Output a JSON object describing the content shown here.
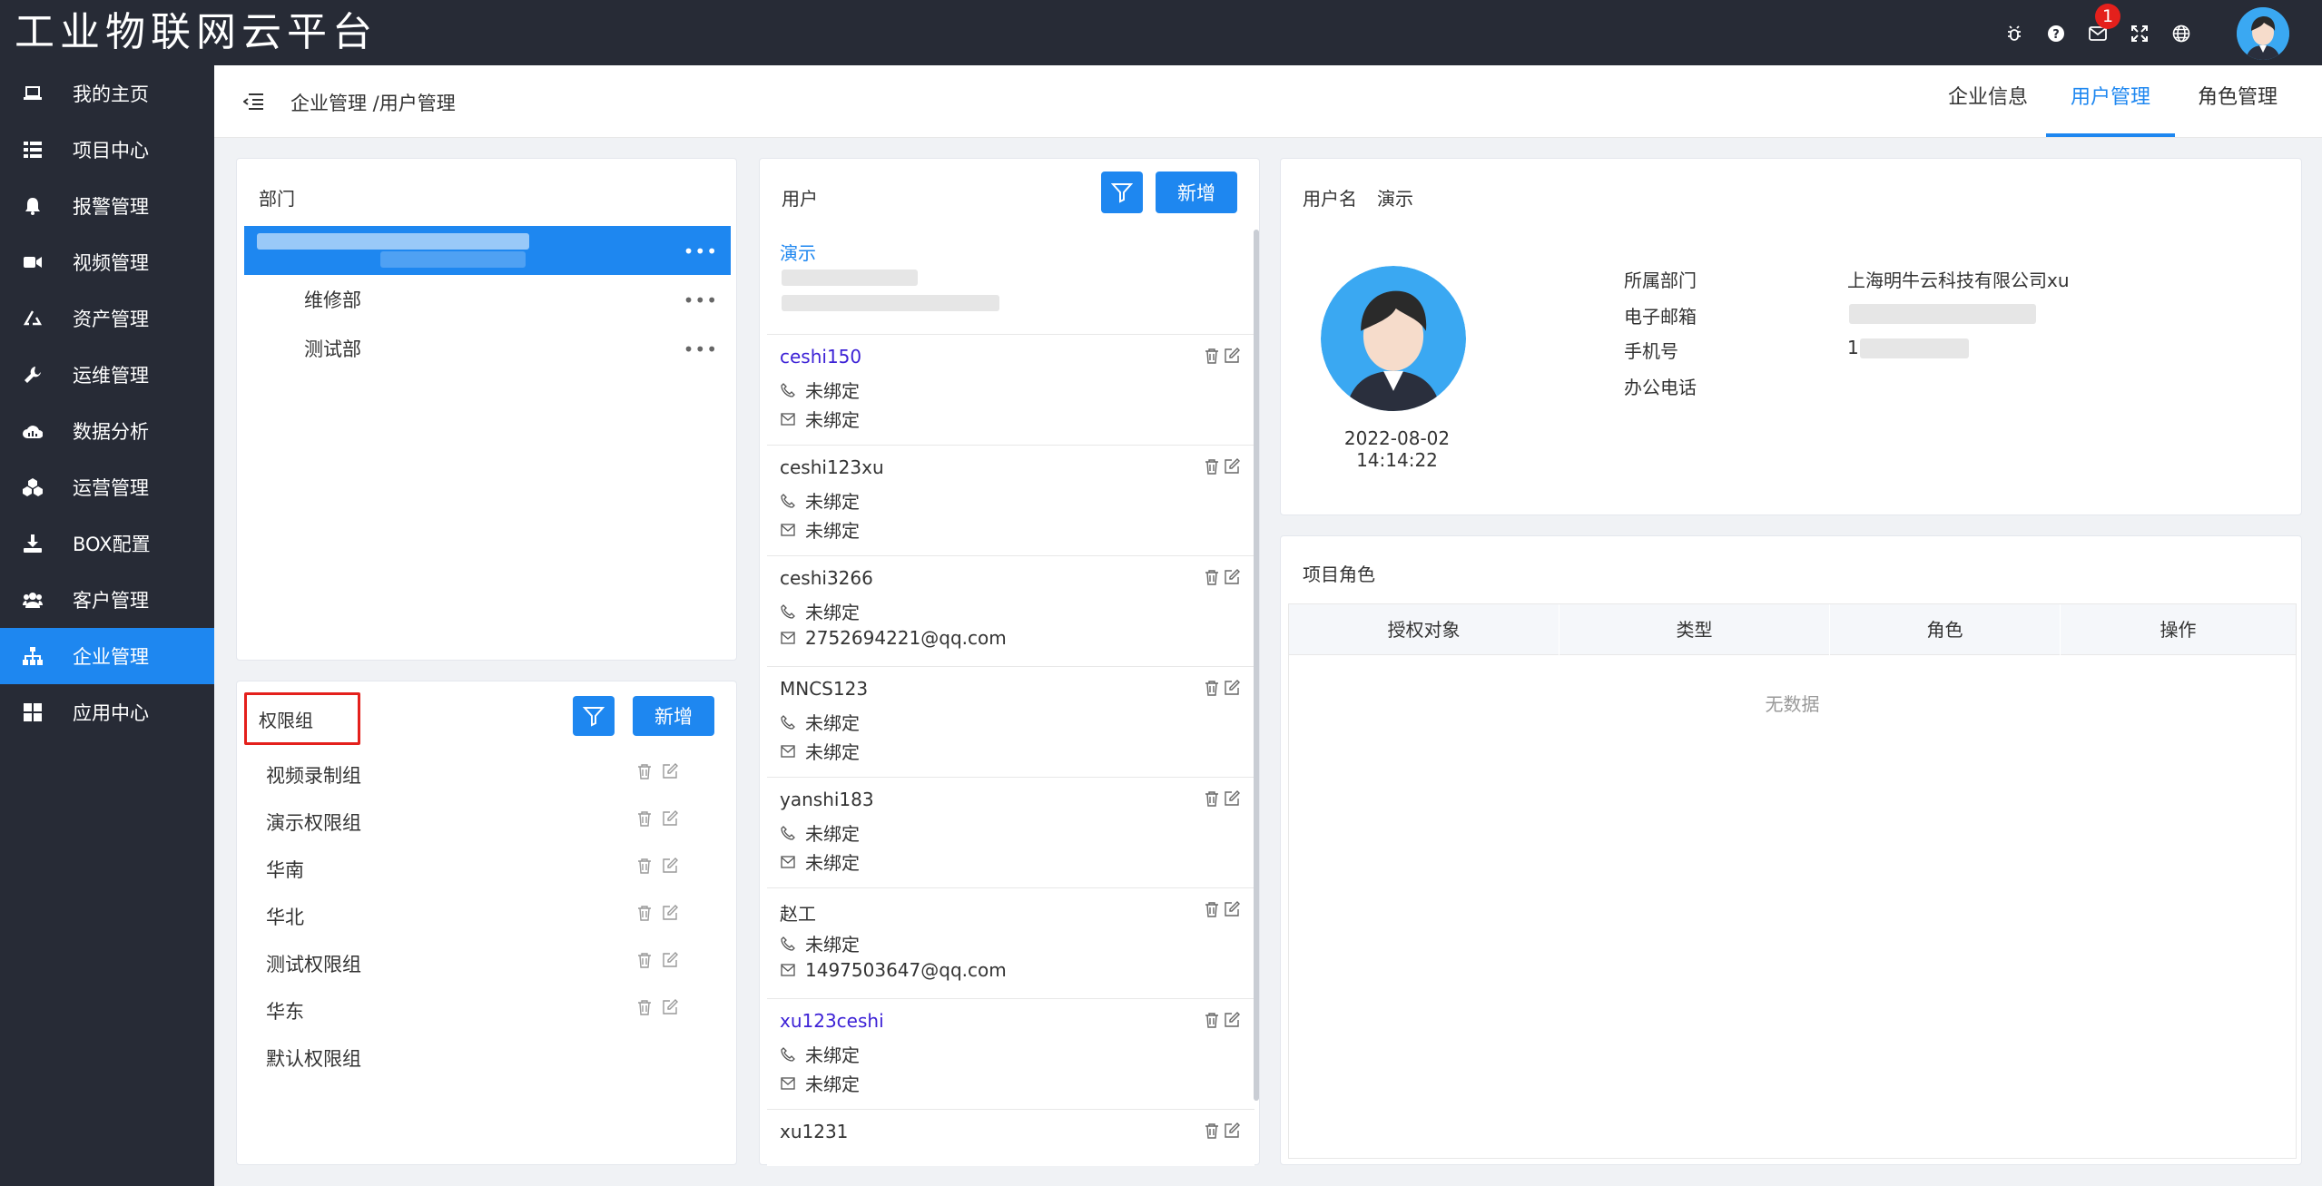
{
  "app": {
    "title": "工业物联网云平台"
  },
  "topbar": {
    "message_count": "1"
  },
  "sidebar": {
    "items": [
      {
        "label": "我的主页",
        "icon": "laptop-icon"
      },
      {
        "label": "项目中心",
        "icon": "list-icon"
      },
      {
        "label": "报警管理",
        "icon": "bell-icon"
      },
      {
        "label": "视频管理",
        "icon": "video-icon"
      },
      {
        "label": "资产管理",
        "icon": "recycle-icon"
      },
      {
        "label": "运维管理",
        "icon": "wrench-icon"
      },
      {
        "label": "数据分析",
        "icon": "cloud-chart-icon"
      },
      {
        "label": "运营管理",
        "icon": "cubes-icon"
      },
      {
        "label": "BOX配置",
        "icon": "download-icon"
      },
      {
        "label": "客户管理",
        "icon": "users-icon"
      },
      {
        "label": "企业管理",
        "icon": "sitemap-icon",
        "active": true
      },
      {
        "label": "应用中心",
        "icon": "grid-icon"
      }
    ]
  },
  "header": {
    "breadcrumb": "企业管理 /用户管理",
    "tabs": [
      {
        "label": "企业信息"
      },
      {
        "label": "用户管理",
        "active": true
      },
      {
        "label": "角色管理"
      }
    ]
  },
  "department": {
    "title": "部门",
    "items": [
      "维修部",
      "测试部"
    ]
  },
  "permission": {
    "title": "权限组",
    "add_label": "新增",
    "items": [
      "视频录制组",
      "演示权限组",
      "华南",
      "华北",
      "测试权限组",
      "华东",
      "默认权限组"
    ]
  },
  "users": {
    "title": "用户",
    "add_label": "新增",
    "first_name": "演示",
    "list": [
      {
        "name": "ceshi150",
        "phone": "未绑定",
        "email": "未绑定"
      },
      {
        "name": "ceshi123xu",
        "phone": "未绑定",
        "email": "未绑定"
      },
      {
        "name": "ceshi3266",
        "phone": "未绑定",
        "email": "2752694221@qq.com"
      },
      {
        "name": "MNCS123",
        "phone": "未绑定",
        "email": "未绑定"
      },
      {
        "name": "yanshi183",
        "phone": "未绑定",
        "email": "未绑定"
      },
      {
        "name": "赵工",
        "phone": "未绑定",
        "email": "1497503647@qq.com"
      },
      {
        "name": "xu123ceshi",
        "phone": "未绑定",
        "email": "未绑定"
      },
      {
        "name": "xu1231",
        "phone": "",
        "email": ""
      }
    ]
  },
  "detail": {
    "username_label": "用户名",
    "username": "演示",
    "created": "2022-08-02 14:14:22",
    "dept_label": "所属部门",
    "dept_value": "上海明牛云科技有限公司xu",
    "email_label": "电子邮箱",
    "phone_label": "手机号",
    "phone_value": "1",
    "office_label": "办公电话"
  },
  "roles": {
    "title": "项目角色",
    "columns": [
      "授权对象",
      "类型",
      "角色",
      "操作"
    ],
    "empty": "无数据"
  },
  "colors": {
    "primary": "#1e87f0",
    "dark": "#272b36",
    "alert": "#e4201c"
  }
}
